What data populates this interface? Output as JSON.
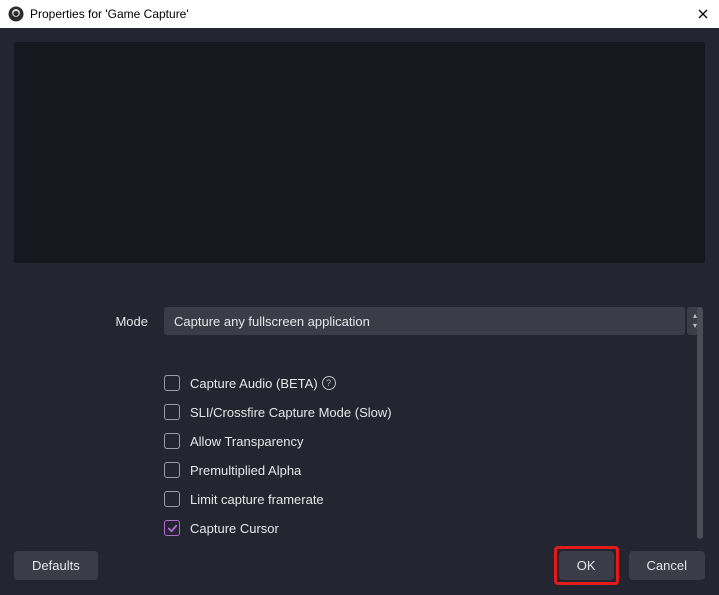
{
  "window": {
    "title": "Properties for 'Game Capture'"
  },
  "mode": {
    "label": "Mode",
    "selected": "Capture any fullscreen application"
  },
  "checkboxes": [
    {
      "label": "Capture Audio (BETA)",
      "checked": false,
      "help": true
    },
    {
      "label": "SLI/Crossfire Capture Mode (Slow)",
      "checked": false,
      "help": false
    },
    {
      "label": "Allow Transparency",
      "checked": false,
      "help": false
    },
    {
      "label": "Premultiplied Alpha",
      "checked": false,
      "help": false
    },
    {
      "label": "Limit capture framerate",
      "checked": false,
      "help": false
    },
    {
      "label": "Capture Cursor",
      "checked": true,
      "help": false
    }
  ],
  "buttons": {
    "defaults": "Defaults",
    "ok": "OK",
    "cancel": "Cancel"
  }
}
